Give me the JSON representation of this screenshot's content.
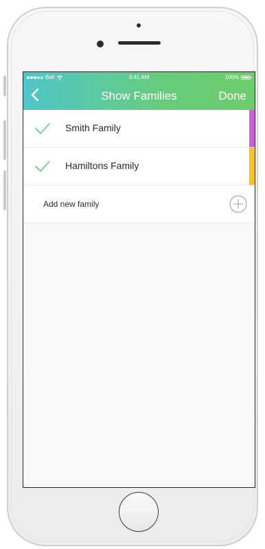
{
  "status_bar": {
    "carrier": "Bell",
    "time": "9:41 AM",
    "battery": "100%"
  },
  "navbar": {
    "title": "Show Families",
    "done_label": "Done",
    "gradient_start": "#4fc6c9",
    "gradient_end": "#6ccd6b",
    "back_icon": "chevron-left-icon"
  },
  "families": [
    {
      "name": "Smith Family",
      "checked": true,
      "color": "#cc5fd6"
    },
    {
      "name": "Hamiltons Family",
      "checked": true,
      "color": "#f7c31c"
    }
  ],
  "add_row": {
    "label": "Add new family",
    "icon": "plus-circle-icon"
  },
  "colors": {
    "check": "#5ccf76"
  }
}
